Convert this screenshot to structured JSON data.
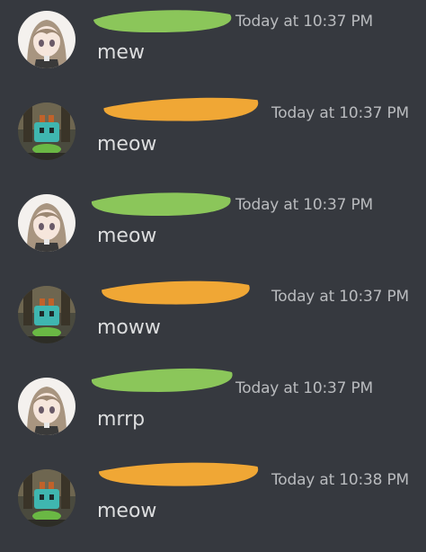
{
  "colors": {
    "background": "#36393f",
    "timestamp": "#b9bbbe",
    "message_text": "#dcddde",
    "scribble_green": "#8bc65a",
    "scribble_orange": "#f0a735"
  },
  "messages": [
    {
      "avatar": "anime-girl-avatar",
      "name_redaction": "green",
      "timestamp": "Today at 10:37 PM",
      "content": "mew"
    },
    {
      "avatar": "robot-avatar",
      "name_redaction": "orange",
      "timestamp": "Today at 10:37 PM",
      "content": "meow"
    },
    {
      "avatar": "anime-girl-avatar",
      "name_redaction": "green",
      "timestamp": "Today at 10:37 PM",
      "content": "meow"
    },
    {
      "avatar": "robot-avatar",
      "name_redaction": "orange",
      "timestamp": "Today at 10:37 PM",
      "content": "moww"
    },
    {
      "avatar": "anime-girl-avatar",
      "name_redaction": "green",
      "timestamp": "Today at 10:37 PM",
      "content": "mrrp"
    },
    {
      "avatar": "robot-avatar",
      "name_redaction": "orange",
      "timestamp": "Today at 10:38 PM",
      "content": "meow"
    }
  ]
}
